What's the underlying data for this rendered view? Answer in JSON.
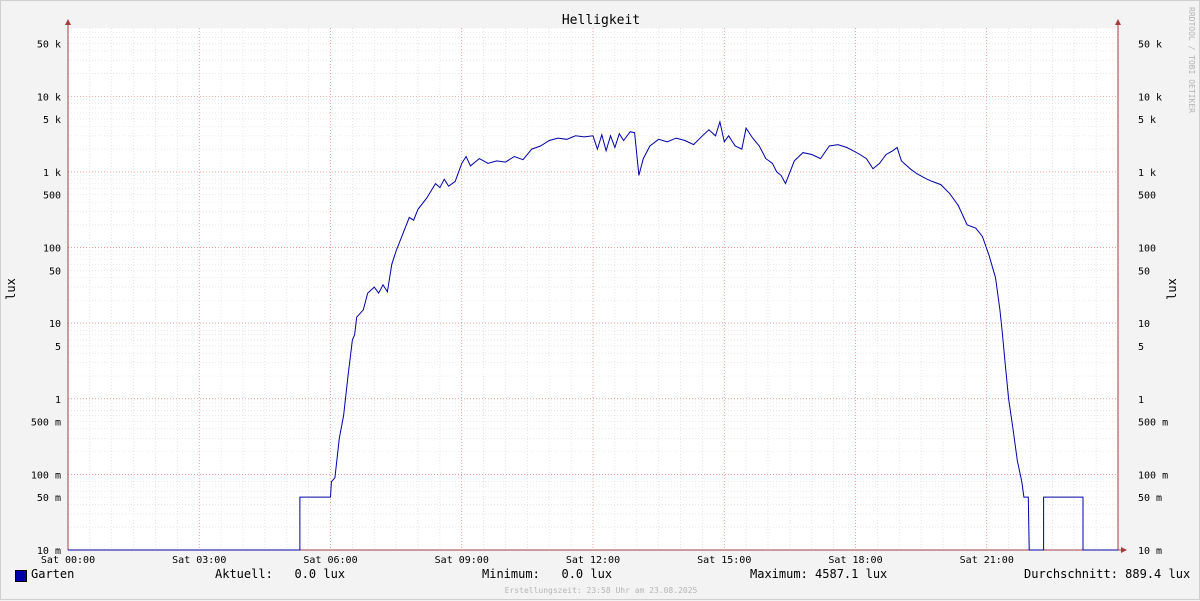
{
  "chart_data": {
    "type": "line",
    "title": "Helligkeit",
    "ylabel": "lux",
    "yscale": "log",
    "ylim": [
      10,
      80000
    ],
    "y_unit": "lux",
    "xlim_hours": [
      0,
      24
    ],
    "x_ticks": [
      {
        "label": "Sat 00:00",
        "hour": 0
      },
      {
        "label": "Sat 03:00",
        "hour": 3
      },
      {
        "label": "Sat 06:00",
        "hour": 6
      },
      {
        "label": "Sat 09:00",
        "hour": 9
      },
      {
        "label": "Sat 12:00",
        "hour": 12
      },
      {
        "label": "Sat 15:00",
        "hour": 15
      },
      {
        "label": "Sat 18:00",
        "hour": 18
      },
      {
        "label": "Sat 21:00",
        "hour": 21
      }
    ],
    "y_ticks": [
      {
        "label": "10 m",
        "value": 0.01
      },
      {
        "label": "50 m",
        "value": 0.05
      },
      {
        "label": "100 m",
        "value": 0.1
      },
      {
        "label": "500 m",
        "value": 0.5
      },
      {
        "label": "1",
        "value": 1
      },
      {
        "label": "5",
        "value": 5
      },
      {
        "label": "10",
        "value": 10
      },
      {
        "label": "50",
        "value": 50
      },
      {
        "label": "100",
        "value": 100
      },
      {
        "label": "500",
        "value": 500
      },
      {
        "label": "1 k",
        "value": 1000
      },
      {
        "label": "5 k",
        "value": 5000
      },
      {
        "label": "10 k",
        "value": 10000
      },
      {
        "label": "50 k",
        "value": 50000
      }
    ],
    "grid": true,
    "series": [
      {
        "name": "Garten",
        "color": "#0000a8",
        "points": [
          [
            0.0,
            0.01
          ],
          [
            5.3,
            0.01
          ],
          [
            5.3,
            0.05
          ],
          [
            6.0,
            0.05
          ],
          [
            6.02,
            0.08
          ],
          [
            6.1,
            0.09
          ],
          [
            6.2,
            0.3
          ],
          [
            6.3,
            0.6
          ],
          [
            6.4,
            2.0
          ],
          [
            6.5,
            6.0
          ],
          [
            6.55,
            7.0
          ],
          [
            6.6,
            12
          ],
          [
            6.75,
            15
          ],
          [
            6.85,
            25
          ],
          [
            7.0,
            30
          ],
          [
            7.1,
            25
          ],
          [
            7.2,
            32
          ],
          [
            7.3,
            26
          ],
          [
            7.4,
            60
          ],
          [
            7.5,
            90
          ],
          [
            7.65,
            150
          ],
          [
            7.8,
            250
          ],
          [
            7.9,
            230
          ],
          [
            8.0,
            320
          ],
          [
            8.2,
            450
          ],
          [
            8.4,
            700
          ],
          [
            8.5,
            620
          ],
          [
            8.6,
            800
          ],
          [
            8.7,
            650
          ],
          [
            8.85,
            750
          ],
          [
            9.0,
            1300
          ],
          [
            9.1,
            1600
          ],
          [
            9.2,
            1200
          ],
          [
            9.4,
            1500
          ],
          [
            9.6,
            1300
          ],
          [
            9.8,
            1400
          ],
          [
            10.0,
            1350
          ],
          [
            10.2,
            1600
          ],
          [
            10.4,
            1450
          ],
          [
            10.6,
            2000
          ],
          [
            10.8,
            2200
          ],
          [
            11.0,
            2600
          ],
          [
            11.2,
            2800
          ],
          [
            11.4,
            2700
          ],
          [
            11.6,
            3000
          ],
          [
            11.8,
            2900
          ],
          [
            12.0,
            3000
          ],
          [
            12.1,
            2000
          ],
          [
            12.2,
            3100
          ],
          [
            12.3,
            1900
          ],
          [
            12.4,
            3000
          ],
          [
            12.5,
            2100
          ],
          [
            12.6,
            3200
          ],
          [
            12.7,
            2600
          ],
          [
            12.85,
            3400
          ],
          [
            12.95,
            3300
          ],
          [
            13.05,
            900
          ],
          [
            13.15,
            1500
          ],
          [
            13.3,
            2200
          ],
          [
            13.5,
            2700
          ],
          [
            13.7,
            2500
          ],
          [
            13.9,
            2800
          ],
          [
            14.1,
            2600
          ],
          [
            14.3,
            2300
          ],
          [
            14.5,
            3000
          ],
          [
            14.65,
            3600
          ],
          [
            14.8,
            3000
          ],
          [
            14.9,
            4587
          ],
          [
            15.0,
            2500
          ],
          [
            15.1,
            3000
          ],
          [
            15.25,
            2200
          ],
          [
            15.4,
            2000
          ],
          [
            15.5,
            3800
          ],
          [
            15.65,
            2800
          ],
          [
            15.8,
            2200
          ],
          [
            15.95,
            1500
          ],
          [
            16.1,
            1300
          ],
          [
            16.2,
            1000
          ],
          [
            16.3,
            900
          ],
          [
            16.4,
            700
          ],
          [
            16.6,
            1400
          ],
          [
            16.8,
            1800
          ],
          [
            17.0,
            1700
          ],
          [
            17.2,
            1500
          ],
          [
            17.4,
            2200
          ],
          [
            17.6,
            2300
          ],
          [
            17.8,
            2100
          ],
          [
            17.95,
            1900
          ],
          [
            18.1,
            1700
          ],
          [
            18.25,
            1500
          ],
          [
            18.4,
            1100
          ],
          [
            18.55,
            1300
          ],
          [
            18.7,
            1700
          ],
          [
            18.85,
            1900
          ],
          [
            18.95,
            2100
          ],
          [
            19.05,
            1400
          ],
          [
            19.25,
            1100
          ],
          [
            19.4,
            950
          ],
          [
            19.6,
            820
          ],
          [
            19.75,
            750
          ],
          [
            19.95,
            680
          ],
          [
            20.15,
            520
          ],
          [
            20.35,
            360
          ],
          [
            20.55,
            200
          ],
          [
            20.75,
            180
          ],
          [
            20.9,
            140
          ],
          [
            21.05,
            80
          ],
          [
            21.2,
            40
          ],
          [
            21.3,
            15
          ],
          [
            21.35,
            8
          ],
          [
            21.42,
            3
          ],
          [
            21.5,
            1
          ],
          [
            21.6,
            0.4
          ],
          [
            21.7,
            0.15
          ],
          [
            21.8,
            0.08
          ],
          [
            21.85,
            0.05
          ],
          [
            21.95,
            0.05
          ],
          [
            21.97,
            0.01
          ],
          [
            22.3,
            0.01
          ],
          [
            22.3,
            0.05
          ],
          [
            23.2,
            0.05
          ],
          [
            23.2,
            0.01
          ],
          [
            24.0,
            0.01
          ]
        ]
      }
    ]
  },
  "legend": {
    "series_name": "Garten",
    "aktuell": "Aktuell:   0.0 lux",
    "minimum": "Minimum:   0.0 lux",
    "maximum": "Maximum: 4587.1 lux",
    "durchschnitt": "Durchschnitt: 889.4 lux"
  },
  "footer": "Erstellungszeit: 23:58 Uhr am 23.08.2025",
  "watermark": "RRDTOOL / TOBI OETIKER",
  "colors": {
    "line": "#0000a8",
    "background": "#f3f3f3",
    "plot_bg": "#ffffff",
    "major_grid": "#e88080",
    "minor_grid": "#d0d0d0",
    "axis": "#a04040"
  }
}
